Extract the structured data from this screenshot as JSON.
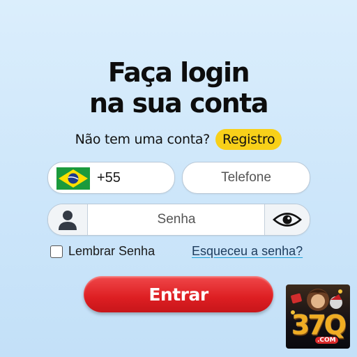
{
  "title": {
    "line1": "Faça login",
    "line2": "na sua conta"
  },
  "signup": {
    "prompt": "Não tem uma conta?",
    "register_label": "Registro"
  },
  "phone": {
    "flag_icon": "brazil-flag-icon",
    "country_code": "+55",
    "placeholder": "Telefone"
  },
  "password": {
    "user_icon": "user-icon",
    "placeholder": "Senha",
    "toggle_icon": "eye-icon"
  },
  "remember": {
    "label": "Lembrar Senha",
    "checked": false
  },
  "forgot_label": "Esqueceu a senha?",
  "submit_label": "Entrar",
  "logo": {
    "text": "37Q",
    "subtext": ".COM"
  },
  "colors": {
    "accent_yellow": "#f8d019",
    "button_red": "#dd1e22",
    "link_underline": "#1aa0d8"
  }
}
